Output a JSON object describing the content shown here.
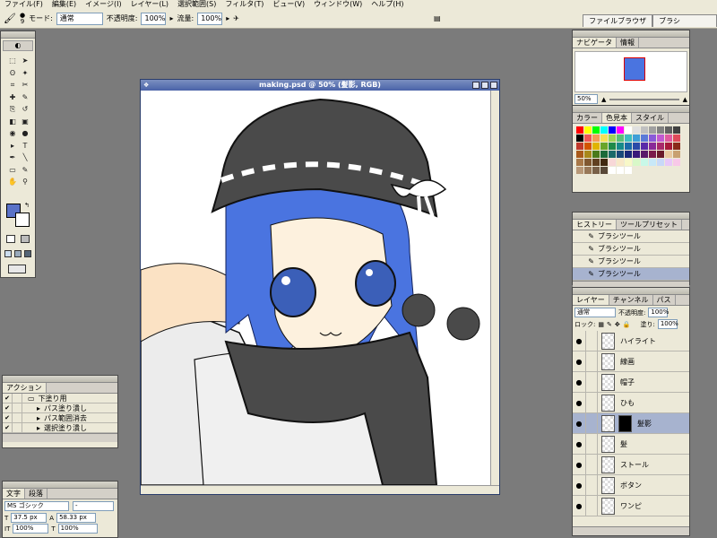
{
  "menu": [
    "ファイル(F)",
    "編集(E)",
    "イメージ(I)",
    "レイヤー(L)",
    "選択範囲(S)",
    "フィルタ(T)",
    "ビュー(V)",
    "ウィンドウ(W)",
    "ヘルプ(H)"
  ],
  "options": {
    "brush_size": "9",
    "mode_label": "モード:",
    "mode_value": "通常",
    "opacity_label": "不透明度:",
    "opacity_value": "100%",
    "flow_label": "流量:",
    "flow_value": "100%"
  },
  "palette_well": [
    "ファイルブラウザ",
    "ブラシ"
  ],
  "document": {
    "title": "making.psd @ 50% (髪影, RGB)"
  },
  "navigator": {
    "tabs": [
      "ナビゲータ",
      "情報"
    ],
    "zoom": "50%"
  },
  "color_panel": {
    "tabs": [
      "カラー",
      "色見本",
      "スタイル"
    ]
  },
  "swatches": [
    "#ff0000",
    "#ffff00",
    "#00ff00",
    "#00ffff",
    "#0000ff",
    "#ff00ff",
    "#ffffff",
    "#e0e0e0",
    "#c0c0c0",
    "#a0a0a0",
    "#808080",
    "#606060",
    "#404040",
    "#000000",
    "#ee5555",
    "#f39c55",
    "#f6e05a",
    "#9fd35a",
    "#5abf7a",
    "#3fbfbf",
    "#3f9fd8",
    "#5a7ad8",
    "#8a5ad8",
    "#c25ad0",
    "#e05a9f",
    "#e04a5a",
    "#c0392b",
    "#d35400",
    "#e0b400",
    "#6aa52a",
    "#1e8a4a",
    "#168a8a",
    "#1a6aa8",
    "#2a4aa8",
    "#5a2aa8",
    "#8a2a98",
    "#a82a6a",
    "#a81a3a",
    "#8a2a1a",
    "#a85a1a",
    "#a8881a",
    "#4a7a1a",
    "#1a6a3a",
    "#1a6a6a",
    "#1a4a7a",
    "#1a2a7a",
    "#3a1a7a",
    "#5a1a6a",
    "#7a1a4a",
    "#6a1a2a",
    "#e8c8a0",
    "#c8a070",
    "#a87848",
    "#805830",
    "#604020",
    "#402810",
    "#f8d8d8",
    "#f8e8c8",
    "#f8f8c8",
    "#d8f8c8",
    "#c8f8e8",
    "#c8e8f8",
    "#c8d8f8",
    "#e8c8f8",
    "#f8c8e8",
    "#b89878",
    "#987858",
    "#786048",
    "#584838",
    "#ffffff",
    "#ffffff",
    "#ffffff"
  ],
  "history": {
    "tabs": [
      "ヒストリー",
      "ツールプリセット"
    ],
    "items": [
      "ブラシツール",
      "ブラシツール",
      "ブラシツール",
      "ブラシツール"
    ]
  },
  "layers": {
    "tabs": [
      "レイヤー",
      "チャンネル",
      "パス"
    ],
    "blend": "通常",
    "opacity_label": "不透明度:",
    "opacity": "100%",
    "lock_label": "ロック:",
    "fill_label": "塗り:",
    "fill": "100%",
    "items": [
      "ハイライト",
      "線画",
      "帽子",
      "ひも",
      "髪影",
      "髪",
      "ストール",
      "ボタン",
      "ワンピ"
    ]
  },
  "actions": {
    "tabs": [
      "アクション"
    ],
    "items": [
      "下塗り用",
      "パス塗り潰し",
      "パス範囲消去",
      "選択塗り潰し"
    ]
  },
  "character": {
    "tabs": [
      "文字",
      "段落"
    ],
    "font": "MS ゴシック",
    "style": "-",
    "size": "37.5 px",
    "leading": "58.33 px",
    "scale_v": "100%",
    "scale_h": "100%"
  },
  "colors": {
    "foreground": "#5a72c8",
    "background": "#ffffff",
    "hair": "#4a74e0",
    "hat": "#4a4a4a"
  }
}
